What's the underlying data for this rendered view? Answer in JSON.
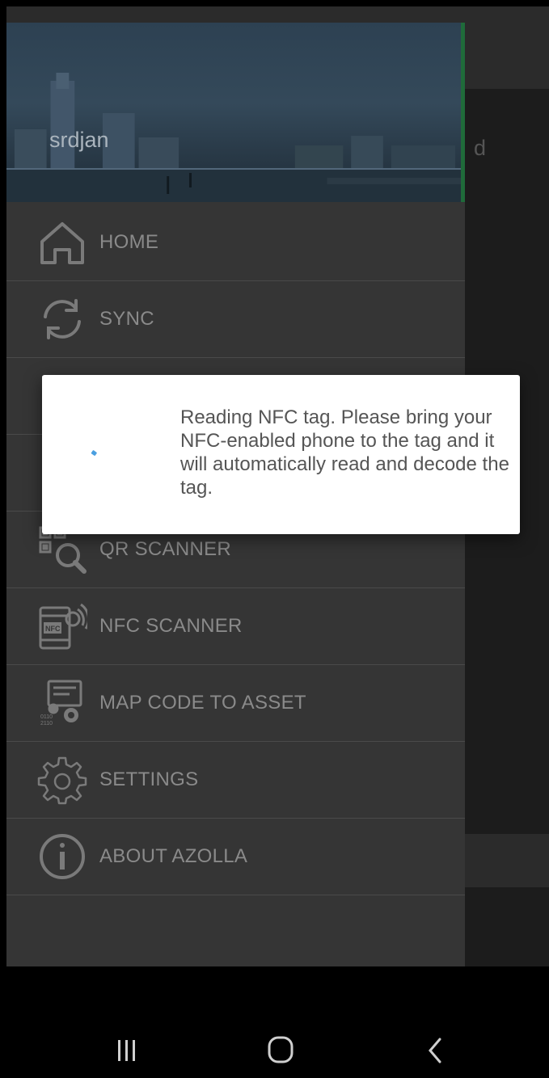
{
  "drawer": {
    "user_name": "srdjan",
    "items": [
      {
        "label": "HOME",
        "icon": "home-icon"
      },
      {
        "label": "SYNC",
        "icon": "sync-icon"
      },
      {
        "label": "",
        "icon": "hidden-icon"
      },
      {
        "label": "",
        "icon": "hidden-icon"
      },
      {
        "label": "QR SCANNER",
        "icon": "qr-scanner-icon"
      },
      {
        "label": "NFC SCANNER",
        "icon": "nfc-scanner-icon"
      },
      {
        "label": "MAP CODE TO ASSET",
        "icon": "map-code-icon"
      },
      {
        "label": "SETTINGS",
        "icon": "gear-icon"
      },
      {
        "label": "ABOUT AZOLLA",
        "icon": "info-icon"
      }
    ]
  },
  "background": {
    "partial_text": "d"
  },
  "dialog": {
    "message": "Reading NFC tag. Please bring your NFC-enabled phone to the tag and it will automatically read and decode the tag."
  },
  "colors": {
    "drawer_bg": "#353535",
    "spinner": "#4a9fe0",
    "dialog_bg": "#ffffff"
  }
}
